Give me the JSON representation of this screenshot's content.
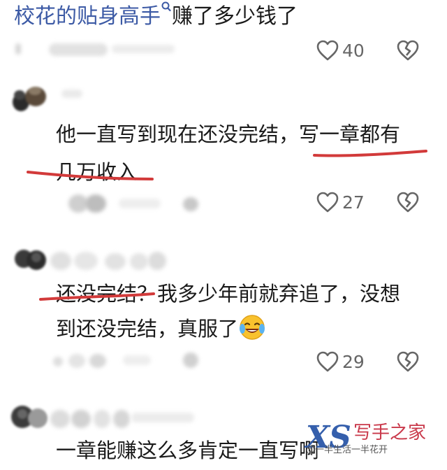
{
  "header": {
    "title_link": "校花的贴身高手",
    "title_rest": "赚了多少钱了"
  },
  "comments": [
    {
      "text_line1_part1": "他一直写到现在还没完结，",
      "text_line1_part2": "写一章都有",
      "text_line2": "几万收入",
      "likes": "27"
    },
    {
      "text_line1_part1": "还没完结？",
      "text_line1_part2": "我多少年前就弃追了，没想",
      "text_line2": "到还没完结，真服了",
      "likes": "29"
    },
    {
      "text_line1": "一章能赚这么多肯定一直写啊"
    }
  ],
  "top_likes": "40",
  "icons": {
    "search": "search-icon",
    "like": "heart-outline-icon",
    "dislike": "broken-heart-icon",
    "emoji": "laughing-tears-emoji"
  },
  "colors": {
    "title_link": "#3c5aa5",
    "underline": "#d23a3a",
    "icon": "#666666"
  },
  "watermark": {
    "logo": "XS",
    "brand": "写手之家",
    "sub": "@一半生活一半花开"
  }
}
